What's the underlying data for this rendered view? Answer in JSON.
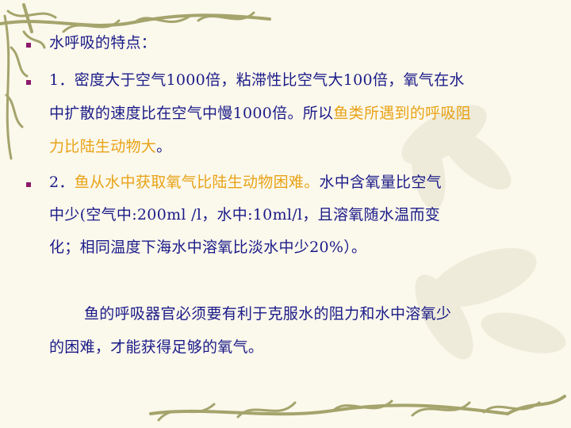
{
  "colors": {
    "text": "#1b1b88",
    "highlight": "#e8a317",
    "bullet": "#8b1a6b",
    "vine": "#9a9a60",
    "background": "#fbf8ec"
  },
  "bullet_icon": "square-bullet",
  "slide": {
    "title": "水呼吸的特点：",
    "point1": {
      "line1": "1．密度大于空气1000倍，粘滞性比空气大100倍，氧气在水",
      "line2_normal": "中扩散的速度比在空气中慢1000倍。所以",
      "line2_highlight": "鱼类所遇到的呼吸阻",
      "line3_highlight": "力比陆生动物大",
      "line3_end": "。"
    },
    "point2": {
      "prefix": "2．",
      "highlight": "鱼从水中获取氧气比陆生动物困难。",
      "line1_rest": "水中含氧量比空气",
      "line2": "中少(空气中:200ml /l，水中:10ml/l，且溶氧随水温而变",
      "line3": "化；相同温度下海水中溶氧比淡水中少20%）。"
    },
    "conclusion": {
      "line1": "鱼的呼吸器官必须要有利于克服水的阻力和水中溶氧少",
      "line2": "的困难，才能获得足够的氧气。"
    }
  }
}
